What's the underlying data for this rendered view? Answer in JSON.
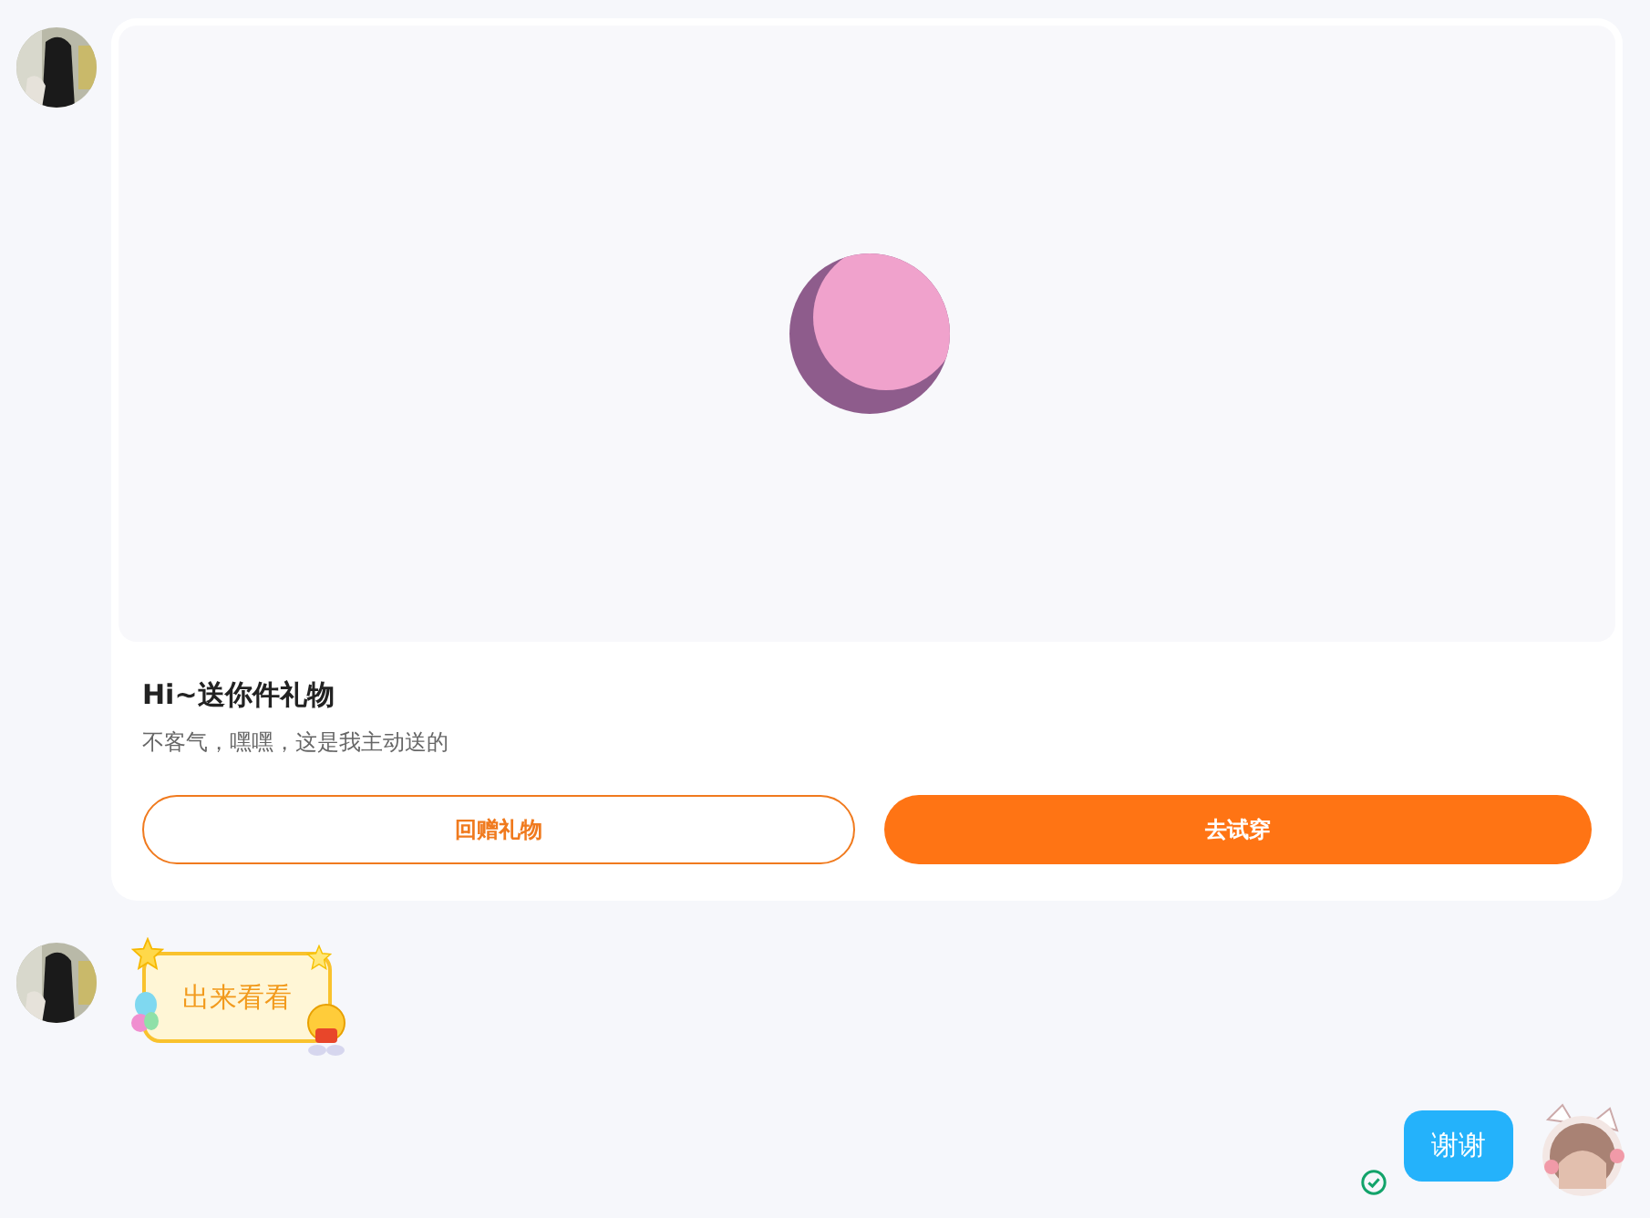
{
  "messages": [
    {
      "kind": "gift_card",
      "outgoing": false,
      "title": "Hi~送你件礼物",
      "subtitle": "不客气，嘿嘿，这是我主动送的",
      "buttons": [
        {
          "label": "回赠礼物",
          "kind": "outline"
        },
        {
          "label": "去试穿",
          "kind": "filled"
        }
      ]
    },
    {
      "kind": "sticker_text",
      "outgoing": false,
      "text": "出来看看"
    },
    {
      "kind": "text",
      "outgoing": true,
      "text": "谢谢"
    }
  ]
}
